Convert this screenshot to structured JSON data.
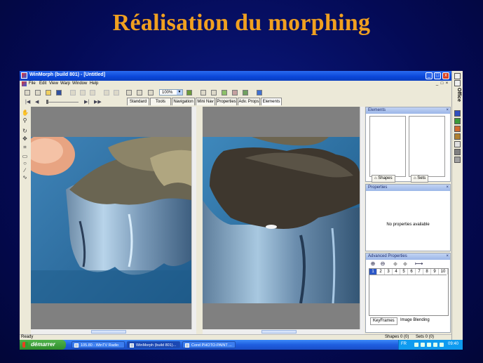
{
  "slide": {
    "title": "Réalisation du morphing"
  },
  "window": {
    "title": "WinMorph (build 801) - [Untitled]",
    "minimize": "_",
    "maximize": "□",
    "close": "x"
  },
  "menu": [
    "File",
    "Edit",
    "View",
    "Warp",
    "Window",
    "Help"
  ],
  "toolbar": {
    "zoom_value": "100%"
  },
  "tabs": [
    "Standard",
    "Tools",
    "Navigation",
    "Mini Nav",
    "Properties",
    "Adv. Props",
    "Elements"
  ],
  "active_tab": "Elements",
  "office_bar": {
    "label": "Office"
  },
  "elements_panel": {
    "title": "Elements",
    "tabs": [
      "Shapes",
      "Sets"
    ]
  },
  "properties_panel": {
    "title": "Properties",
    "empty_text": "No properties available"
  },
  "advanced_panel": {
    "title": "Advanced Properties",
    "keyframes": [
      "1",
      "2",
      "3",
      "4",
      "5",
      "6",
      "7",
      "8",
      "9",
      "10"
    ],
    "selected_keyframe": "1",
    "tabs": [
      "KeyFrames",
      "Image Blending"
    ]
  },
  "status": {
    "left": "Ready",
    "shapes": "Shapes 0 (0)",
    "sets": "Sets 0 (0)"
  },
  "taskbar": {
    "start_label": "démarrer",
    "tasks": [
      {
        "label": "105.80 - WinTV Radio"
      },
      {
        "label": "WinMorph (build 801)..."
      },
      {
        "label": "Corel PHOTO-PAINT ..."
      }
    ],
    "language": "FR",
    "clock": "09:40"
  },
  "colors": {
    "title_orange": "#f0a020",
    "slide_background": "#06107a",
    "xp_blue": "#0a46d8",
    "start_green": "#3a9a36"
  },
  "icons": {
    "toolbox": [
      "hand-icon",
      "zoom-icon",
      "rotate-icon",
      "move-icon",
      "crop-icon",
      "rectangle-icon",
      "ellipse-icon",
      "line-icon",
      "curve-icon"
    ],
    "office_strip": [
      "word-icon",
      "excel-icon",
      "powerpoint-icon",
      "access-icon",
      "outlook-icon",
      "office-icon"
    ]
  }
}
